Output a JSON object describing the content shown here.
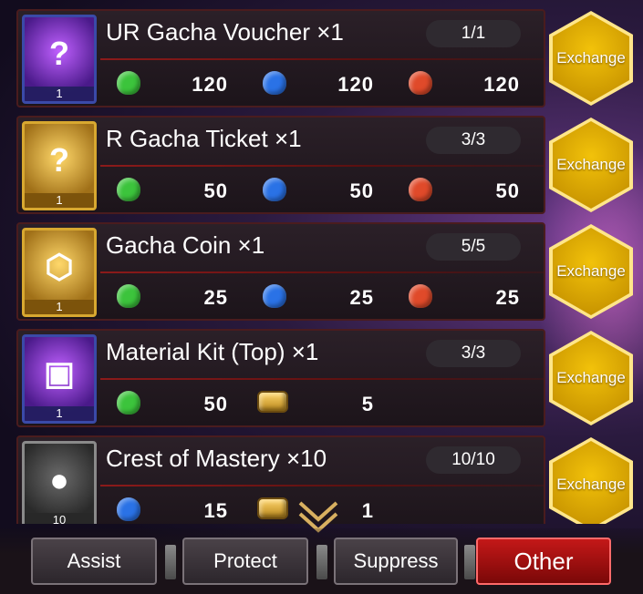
{
  "items": [
    {
      "name": "UR Gacha Voucher",
      "qty": "×1",
      "limit": "1/1",
      "thumb_count": "1",
      "thumb_style": "purple",
      "thumb_icon": "ur-voucher-icon",
      "costs": [
        {
          "icon": "green-gem-icon",
          "amount": "120"
        },
        {
          "icon": "blue-gem-icon",
          "amount": "120"
        },
        {
          "icon": "red-gem-icon",
          "amount": "120"
        }
      ],
      "button_label": "Exchange"
    },
    {
      "name": "R Gacha Ticket",
      "qty": "×1",
      "limit": "3/3",
      "thumb_count": "1",
      "thumb_style": "gold",
      "thumb_icon": "r-ticket-icon",
      "costs": [
        {
          "icon": "green-gem-icon",
          "amount": "50"
        },
        {
          "icon": "blue-gem-icon",
          "amount": "50"
        },
        {
          "icon": "red-gem-icon",
          "amount": "50"
        }
      ],
      "button_label": "Exchange"
    },
    {
      "name": "Gacha Coin",
      "qty": "×1",
      "limit": "5/5",
      "thumb_count": "1",
      "thumb_style": "gold",
      "thumb_icon": "gacha-coin-icon",
      "costs": [
        {
          "icon": "green-gem-icon",
          "amount": "25"
        },
        {
          "icon": "blue-gem-icon",
          "amount": "25"
        },
        {
          "icon": "red-gem-icon",
          "amount": "25"
        }
      ],
      "button_label": "Exchange"
    },
    {
      "name": "Material Kit (Top)",
      "qty": "×1",
      "limit": "3/3",
      "thumb_count": "1",
      "thumb_style": "purple",
      "thumb_icon": "material-kit-icon",
      "costs": [
        {
          "icon": "green-gem-icon",
          "amount": "50"
        },
        {
          "icon": "treasure-chest-icon",
          "amount": "5"
        }
      ],
      "button_label": "Exchange"
    },
    {
      "name": "Crest of Mastery",
      "qty": "×10",
      "limit": "10/10",
      "thumb_count": "10",
      "thumb_style": "gray",
      "thumb_icon": "crest-icon",
      "costs": [
        {
          "icon": "blue-gem-icon",
          "amount": "15"
        },
        {
          "icon": "treasure-chest-icon",
          "amount": "1"
        }
      ],
      "button_label": "Exchange"
    }
  ],
  "tabs": [
    {
      "label": "Assist",
      "active": false
    },
    {
      "label": "Protect",
      "active": false
    },
    {
      "label": "Suppress",
      "active": false
    },
    {
      "label": "Other",
      "active": true
    }
  ],
  "colors": {
    "accent_gold": "#f2c20a",
    "active_tab": "#c41818",
    "row_border": "#4a1c1e"
  }
}
